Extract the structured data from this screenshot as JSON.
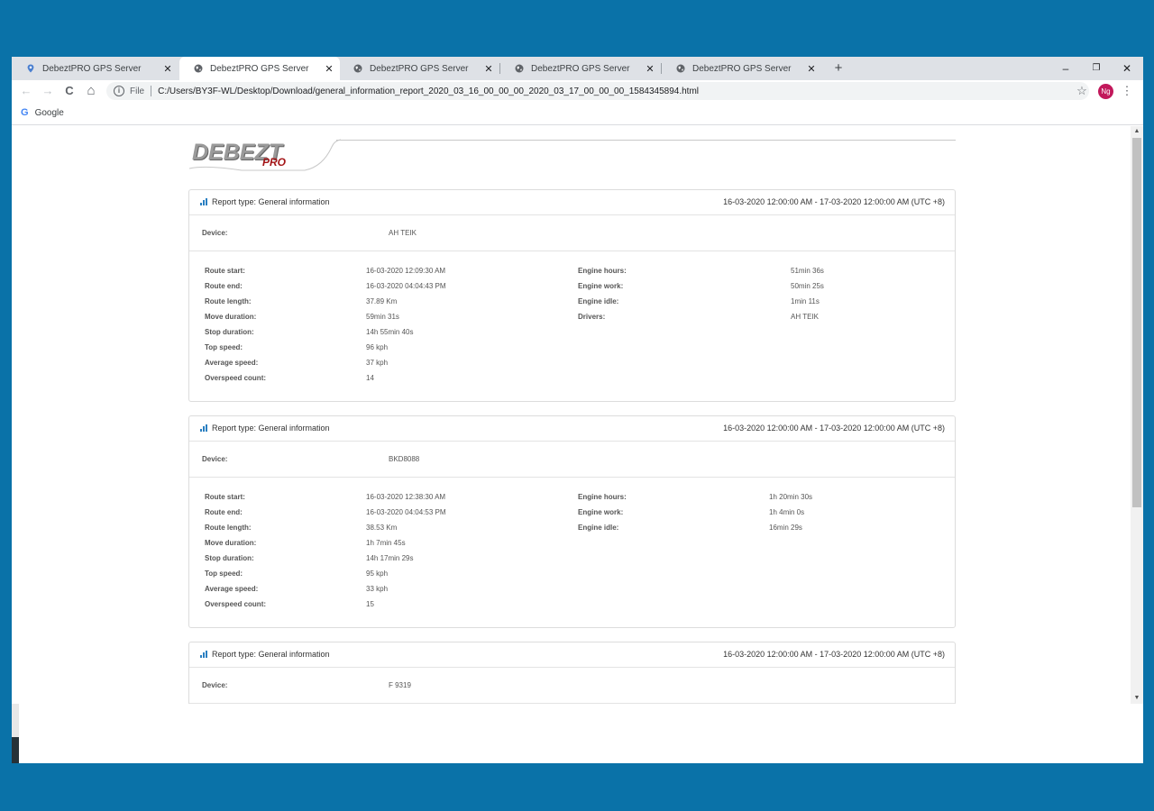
{
  "browser": {
    "tabs": [
      {
        "title": "DebeztPRO GPS Server",
        "icon": "map-pin-icon",
        "active": false
      },
      {
        "title": "DebeztPRO GPS Server",
        "icon": "globe-icon",
        "active": true
      },
      {
        "title": "DebeztPRO GPS Server",
        "icon": "globe-icon",
        "active": false
      },
      {
        "title": "DebeztPRO GPS Server",
        "icon": "globe-icon",
        "active": false
      },
      {
        "title": "DebeztPRO GPS Server",
        "icon": "globe-icon",
        "active": false
      }
    ],
    "new_tab": "+",
    "window_controls": {
      "minimize": "–",
      "restore": "❐",
      "close": "✕"
    },
    "toolbar": {
      "back": "←",
      "forward": "→",
      "reload": "C",
      "home": "⌂",
      "info": "i",
      "file_label": "File",
      "url": "C:/Users/BY3F-WL/Desktop/Download/general_information_report_2020_03_16_00_00_00_2020_03_17_00_00_00_1584345894.html",
      "star": "☆",
      "avatar": "Ng",
      "menu": "⋮"
    },
    "bookmarks": [
      {
        "label": "Google",
        "icon": "google-icon",
        "glyph": "G"
      }
    ],
    "scroll": {
      "up": "▲",
      "down": "▼"
    }
  },
  "logo": {
    "main": "DEBEZT",
    "sub": "PRO"
  },
  "reports": [
    {
      "report_type": "Report type: General information",
      "period": "16-03-2020 12:00:00 AM - 17-03-2020 12:00:00 AM (UTC +8)",
      "device_label": "Device:",
      "device": "AH TEIK",
      "left": [
        {
          "label": "Route start:",
          "value": "16-03-2020 12:09:30 AM"
        },
        {
          "label": "Route end:",
          "value": "16-03-2020 04:04:43 PM"
        },
        {
          "label": "Route length:",
          "value": "37.89 Km"
        },
        {
          "label": "Move duration:",
          "value": "59min 31s"
        },
        {
          "label": "Stop duration:",
          "value": "14h 55min 40s"
        },
        {
          "label": "Top speed:",
          "value": "96 kph"
        },
        {
          "label": "Average speed:",
          "value": "37 kph"
        },
        {
          "label": "Overspeed count:",
          "value": "14"
        }
      ],
      "right": [
        {
          "label": "Engine hours:",
          "value": "51min 36s"
        },
        {
          "label": "Engine work:",
          "value": "50min 25s"
        },
        {
          "label": "Engine idle:",
          "value": "1min 11s"
        },
        {
          "label": "Drivers:",
          "value": "AH TEIK"
        }
      ]
    },
    {
      "report_type": "Report type: General information",
      "period": "16-03-2020 12:00:00 AM - 17-03-2020 12:00:00 AM (UTC +8)",
      "device_label": "Device:",
      "device": "BKD8088",
      "left": [
        {
          "label": "Route start:",
          "value": "16-03-2020 12:38:30 AM"
        },
        {
          "label": "Route end:",
          "value": "16-03-2020 04:04:53 PM"
        },
        {
          "label": "Route length:",
          "value": "38.53 Km"
        },
        {
          "label": "Move duration:",
          "value": "1h 7min 45s"
        },
        {
          "label": "Stop duration:",
          "value": "14h 17min 29s"
        },
        {
          "label": "Top speed:",
          "value": "95 kph"
        },
        {
          "label": "Average speed:",
          "value": "33 kph"
        },
        {
          "label": "Overspeed count:",
          "value": "15"
        }
      ],
      "right": [
        {
          "label": "Engine hours:",
          "value": "1h 20min 30s"
        },
        {
          "label": "Engine work:",
          "value": "1h 4min 0s"
        },
        {
          "label": "Engine idle:",
          "value": "16min 29s"
        }
      ]
    },
    {
      "report_type": "Report type: General information",
      "period": "16-03-2020 12:00:00 AM - 17-03-2020 12:00:00 AM (UTC +8)",
      "device_label": "Device:",
      "device": "F 9319",
      "left": [],
      "right": []
    }
  ]
}
